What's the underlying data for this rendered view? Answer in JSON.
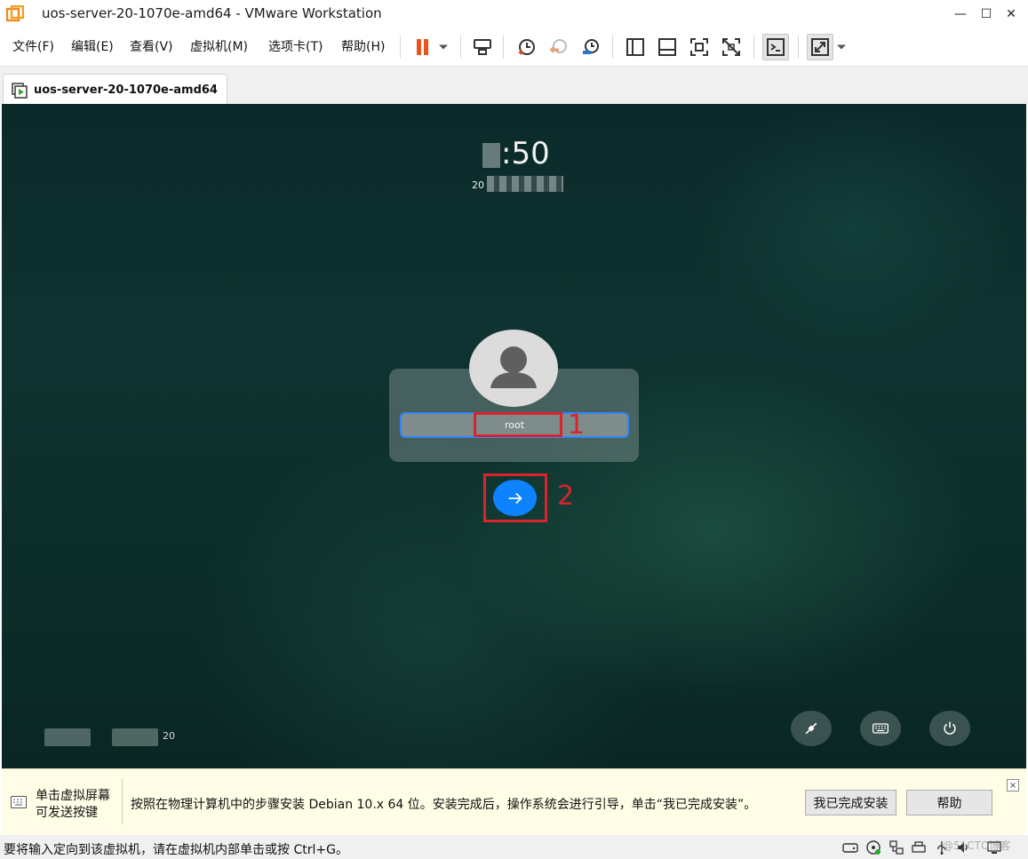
{
  "window": {
    "title": "uos-server-20-1070e-amd64 - VMware Workstation",
    "controls": {
      "minimize": "—",
      "maximize": "☐",
      "close": "✕"
    }
  },
  "menu": {
    "items": [
      "文件(F)",
      "编辑(E)",
      "查看(V)",
      "虚拟机(M)",
      "选项卡(T)",
      "帮助(H)"
    ]
  },
  "toolbar": {
    "icons": [
      "pause-icon",
      "dropdown-arrow-icon",
      "send-ctrl-alt-del-icon",
      "snapshot-take-icon",
      "snapshot-revert-icon",
      "snapshot-manager-icon",
      "view-library-icon",
      "view-thumbnail-icon",
      "view-fullscreen-icon",
      "view-unity-icon",
      "console-icon",
      "stretch-icon",
      "dropdown-arrow-icon"
    ],
    "accent_pause": "#e8541c",
    "accent_snapshot": "#d04a16"
  },
  "tab": {
    "label": "uos-server-20-1070e-amd64"
  },
  "vm": {
    "clock": ":50",
    "date_prefix": "20",
    "username": "root",
    "annotation_1": "1",
    "annotation_2": "2",
    "bottom_number": "20",
    "annotation_color": "#d9242c",
    "accent_blue": "#0d83ff",
    "round_buttons": [
      "network-plug-icon",
      "keyboard-icon",
      "power-icon"
    ]
  },
  "notification": {
    "tip_line1": "单击虚拟屏幕",
    "tip_line2": "可发送按键",
    "message": "按照在物理计算机中的步骤安装 Debian 10.x 64 位。安装完成后，操作系统会进行引导，单击“我已完成安装”。",
    "done_button": "我已完成安装",
    "help_button": "帮助",
    "close": "×"
  },
  "status": {
    "text": "要将输入定向到该虚拟机，请在虚拟机内部单击或按 Ctrl+G。",
    "watermark": "@51CTO博客",
    "icons": [
      "hard-disk-icon",
      "cd-rom-icon",
      "network-icon",
      "printer-icon",
      "usb-icon",
      "sound-icon",
      "display-icon"
    ]
  }
}
